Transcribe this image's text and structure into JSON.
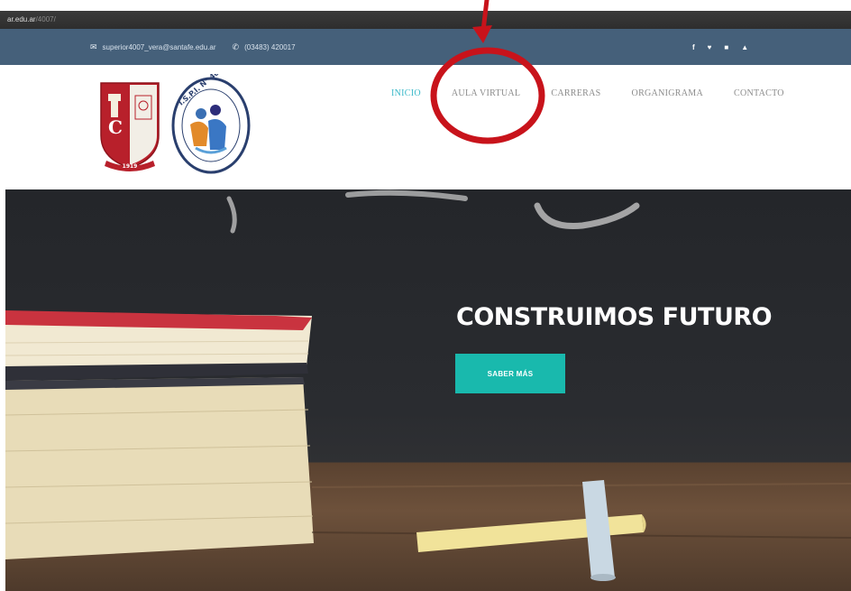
{
  "browser": {
    "url_main": "ar.edu.ar",
    "url_rest": "/4007/"
  },
  "topbar": {
    "mail_icon": "envelope-icon",
    "email": "superior4007_vera@santafe.edu.ar",
    "phone_icon": "phone-icon",
    "phone": "(03483) 420017",
    "social": [
      {
        "icon": "facebook-icon",
        "glyph": "f"
      },
      {
        "icon": "twitter-icon",
        "glyph": "🐦"
      },
      {
        "icon": "instagram-icon",
        "glyph": "◙"
      },
      {
        "icon": "youtube-icon",
        "glyph": "▲"
      }
    ]
  },
  "logos": {
    "left_year": "1919",
    "right_text": "I.S.P.I. N° 4007"
  },
  "nav": {
    "items": [
      {
        "label": "INICIO",
        "active": true
      },
      {
        "label": "AULA VIRTUAL",
        "active": false
      },
      {
        "label": "CARRERAS",
        "active": false
      },
      {
        "label": "ORGANIGRAMA",
        "active": false
      },
      {
        "label": "CONTACTO",
        "active": false
      }
    ]
  },
  "hero": {
    "title": "CONSTRUIMOS FUTURO",
    "button": "SABER MÁS"
  },
  "colors": {
    "topbar": "#45607a",
    "accent": "#38b8c8",
    "button": "#19b9ad",
    "annotation": "#c8131b"
  }
}
